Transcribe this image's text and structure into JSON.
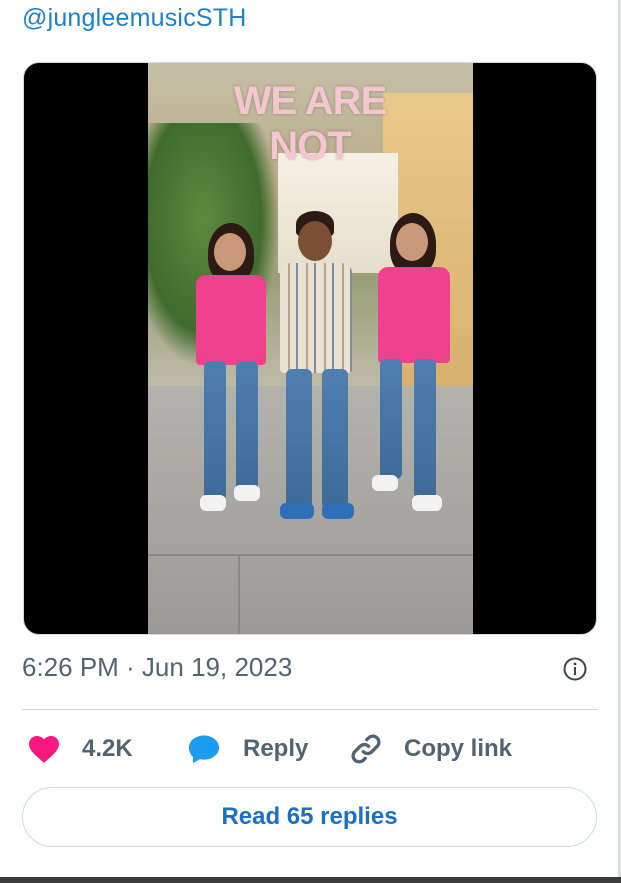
{
  "tweet": {
    "handle": "@jungleemusicSTH",
    "media": {
      "overlay_text": "WE ARE NOT"
    },
    "timestamp": "6:26 PM · Jun 19, 2023"
  },
  "actions": {
    "likes": "4.2K",
    "reply_label": "Reply",
    "copy_link_label": "Copy link"
  },
  "footer": {
    "read_replies_label": "Read 65 replies"
  },
  "colors": {
    "link_blue": "#1d80c9",
    "like_pink": "#f91880",
    "reply_blue": "#1d9bf0",
    "muted_text": "#536471"
  },
  "icons": {
    "like": "heart-icon",
    "reply": "speech-bubble-icon",
    "copy_link": "chain-link-icon",
    "info": "info-icon"
  }
}
